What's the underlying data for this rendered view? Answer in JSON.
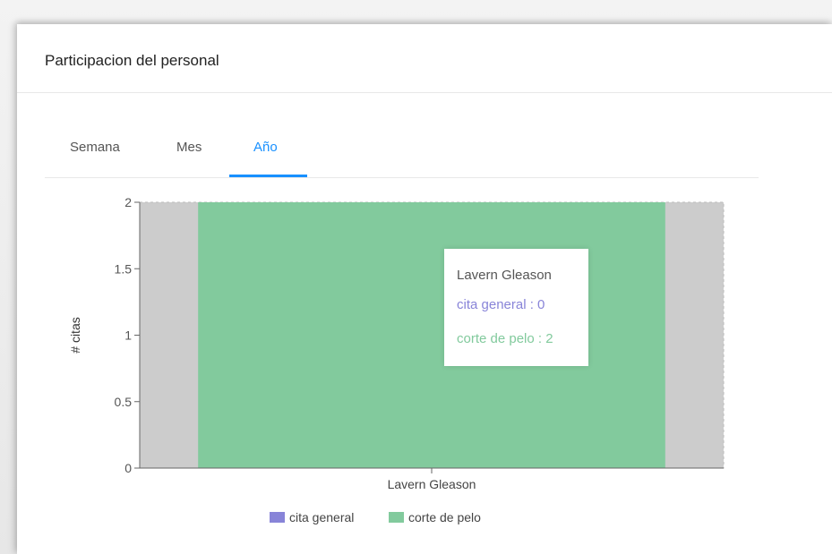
{
  "card": {
    "title": "Participacion del personal"
  },
  "tabs": [
    {
      "label": "Semana",
      "active": false
    },
    {
      "label": "Mes",
      "active": false
    },
    {
      "label": "Año",
      "active": true
    }
  ],
  "colors": {
    "accent": "#1890ff",
    "cita_general": "#8884d8",
    "corte_de_pelo": "#82ca9d",
    "cursor_band": "#cccccc"
  },
  "chart_data": {
    "type": "bar",
    "stacked": true,
    "categories": [
      "Lavern Gleason"
    ],
    "series": [
      {
        "name": "cita general",
        "values": [
          0
        ],
        "color": "#8884d8"
      },
      {
        "name": "corte de pelo",
        "values": [
          2
        ],
        "color": "#82ca9d"
      }
    ],
    "ylabel": "# citas",
    "xlabel": "",
    "ylim": [
      0,
      2
    ],
    "yticks": [
      "0",
      "0.5",
      "1",
      "1.5",
      "2"
    ],
    "grid": true,
    "legend": "bottom"
  },
  "tooltip": {
    "title": "Lavern Gleason",
    "row1": "cita general : 0",
    "row2": "corte de pelo : 2"
  },
  "legend": [
    {
      "label": "cita general",
      "color": "#8884d8"
    },
    {
      "label": "corte de pelo",
      "color": "#82ca9d"
    }
  ]
}
